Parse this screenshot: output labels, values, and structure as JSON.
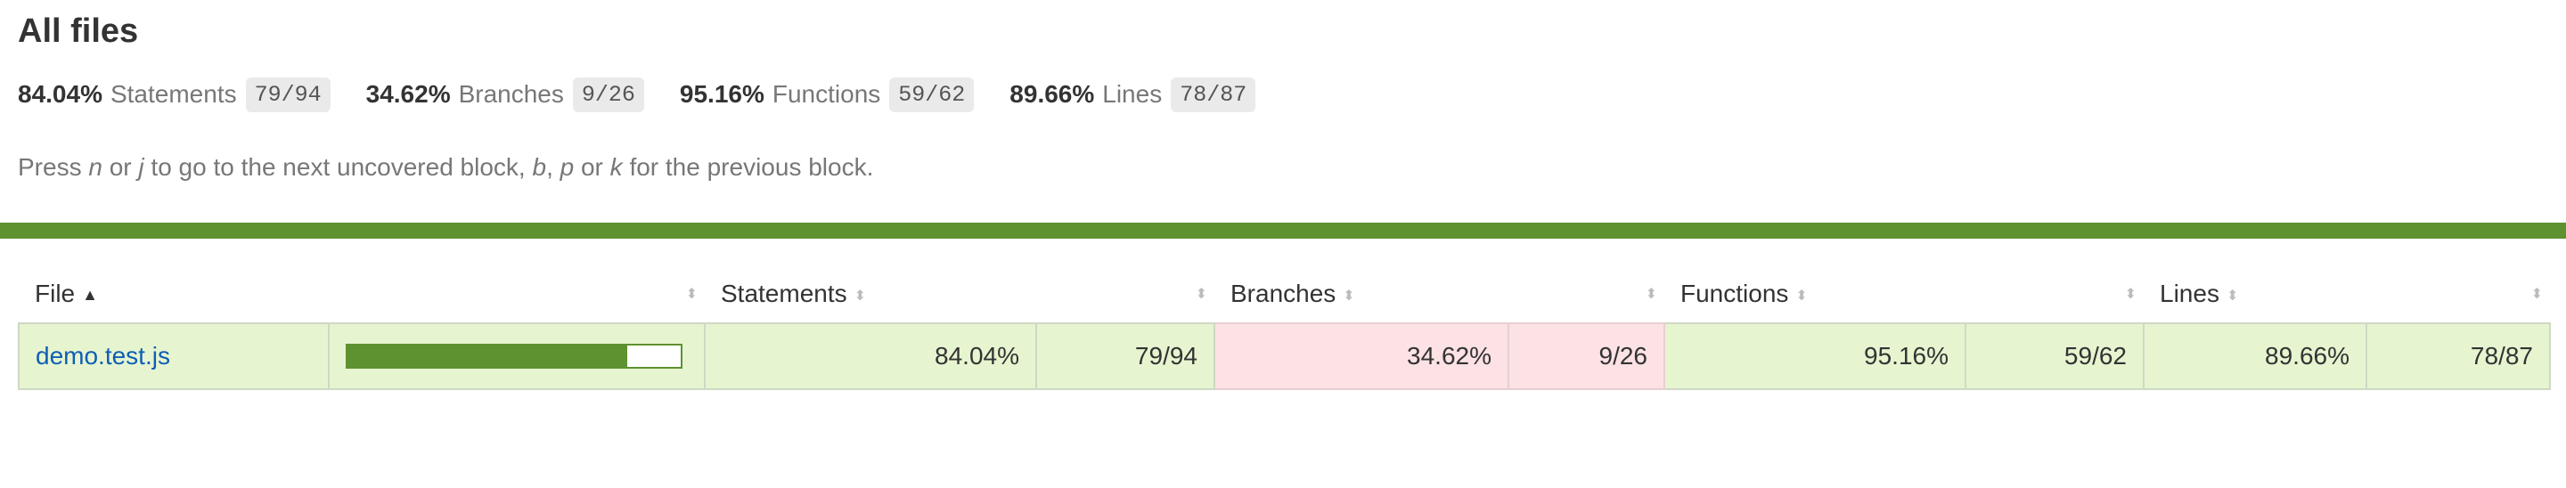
{
  "title": "All files",
  "summary": [
    {
      "pct": "84.04%",
      "label": "Statements",
      "fraction": "79/94"
    },
    {
      "pct": "34.62%",
      "label": "Branches",
      "fraction": "9/26"
    },
    {
      "pct": "95.16%",
      "label": "Functions",
      "fraction": "59/62"
    },
    {
      "pct": "89.66%",
      "label": "Lines",
      "fraction": "78/87"
    }
  ],
  "hint": {
    "p1": "Press ",
    "k1": "n",
    "p2": " or ",
    "k2": "j",
    "p3": " to go to the next uncovered block, ",
    "k3": "b",
    "p4": ", ",
    "k4": "p",
    "p5": " or ",
    "k5": "k",
    "p6": " for the previous block."
  },
  "colors": {
    "status_high": "#5e912f",
    "row_high": "#e6f5d0",
    "row_low": "#fce1e5",
    "link": "#0e5fb4"
  },
  "table": {
    "headers": {
      "file": "File",
      "statements": "Statements",
      "branches": "Branches",
      "functions": "Functions",
      "lines": "Lines"
    },
    "icons": {
      "sort_active": "sort-ascending-icon",
      "sort": "sort-icon"
    },
    "rows": [
      {
        "file": "demo.test.js",
        "coverage_bar_fraction": 0.8404,
        "statements_pct": "84.04%",
        "statements_frac": "79/94",
        "branches_pct": "34.62%",
        "branches_frac": "9/26",
        "functions_pct": "95.16%",
        "functions_frac": "59/62",
        "lines_pct": "89.66%",
        "lines_frac": "78/87"
      }
    ]
  }
}
